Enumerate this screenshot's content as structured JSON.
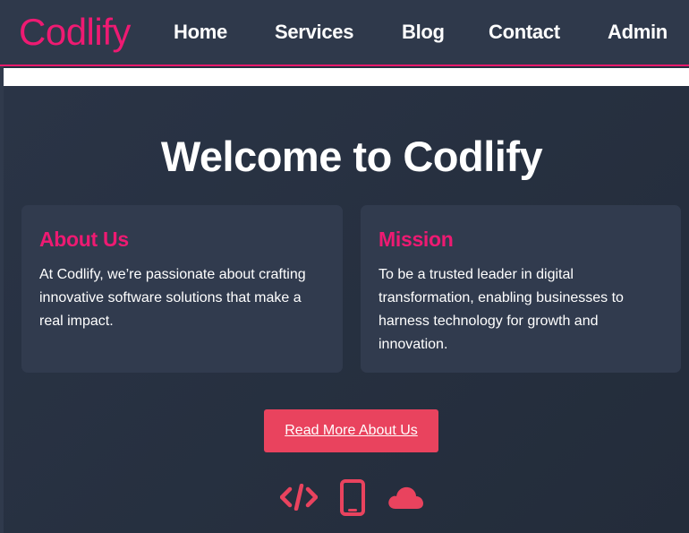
{
  "nav": {
    "brand": "Codlify",
    "links": [
      "Home",
      "Services",
      "Blog",
      "Contact",
      "Admin"
    ]
  },
  "hero": {
    "title": "Welcome to Codlify"
  },
  "cards": [
    {
      "heading": "About Us",
      "text": "At Codlify, we’re passionate about crafting innovative software solutions that make a real impact."
    },
    {
      "heading": "Mission",
      "text": "To be a trusted leader in digital transformation, enabling businesses to harness technology for growth and innovation."
    }
  ],
  "cta": {
    "label": "Read More About Us"
  },
  "icons": [
    "code-icon",
    "mobile-phone-icon",
    "cloud-icon"
  ],
  "colors": {
    "accent": "#ee1a72",
    "button": "#e9435e",
    "navbar": "#2f394b",
    "card": "#313b4e",
    "background": "#263040"
  }
}
